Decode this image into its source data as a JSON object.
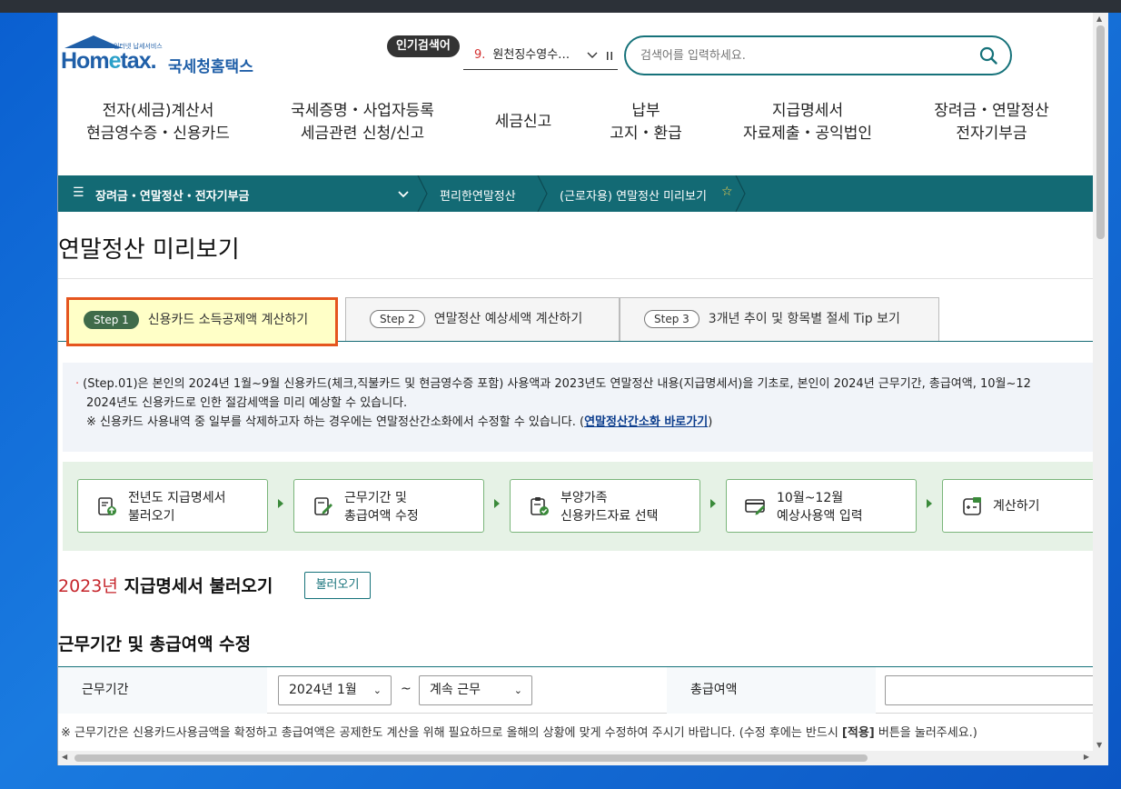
{
  "header": {
    "logo_small": "인터넷 납세서비스",
    "logo_brand_a": "Hom",
    "logo_brand_e": "e",
    "logo_brand_b": "tax.",
    "logo_ko": "국세청홈택스",
    "popular_label": "인기검색어",
    "popular_num": "9.",
    "popular_text": "원천징수영수…",
    "search_placeholder": "검색어를 입력하세요."
  },
  "gnb": [
    {
      "line1": "전자(세금)계산서",
      "line2": "현금영수증・신용카드"
    },
    {
      "line1": "국세증명・사업자등록",
      "line2": "세금관련 신청/신고"
    },
    {
      "line1": "세금신고",
      "line2": ""
    },
    {
      "line1": "납부",
      "line2": "고지・환급"
    },
    {
      "line1": "지급명세서",
      "line2": "자료제출・공익법인"
    },
    {
      "line1": "장려금・연말정산",
      "line2": "전자기부금"
    }
  ],
  "location": {
    "category": "장려금・연말정산・전자기부금",
    "crumb1": "편리한연말정산",
    "crumb2": "(근로자용) 연말정산 미리보기"
  },
  "page_title": "연말정산 미리보기",
  "tabs": [
    {
      "step": "Step 1",
      "label": "신용카드 소득공제액 계산하기"
    },
    {
      "step": "Step 2",
      "label": "연말정산 예상세액 계산하기"
    },
    {
      "step": "Step 3",
      "label": "3개년 추이 및 항목별 절세 Tip 보기"
    }
  ],
  "notice": {
    "line1": "(Step.01)은 본인의 2024년 1월~9월 신용카드(체크,직불카드 및 현금영수증 포함) 사용액과 2023년도 연말정산 내용(지급명세서)을 기초로, 본인이 2024년 근무기간, 총급여액, 10월~12",
    "line2": "2024년도 신용카드로 인한 절감세액을 미리 예상할 수 있습니다.",
    "line3_prefix": "※ 신용카드 사용내역 중 일부를 삭제하고자 하는 경우에는 연말정산간소화에서 수정할 수 있습니다. (",
    "line3_link": "연말정산간소화 바로가기",
    "line3_suffix": ")"
  },
  "steps": [
    {
      "line1": "전년도 지급명세서",
      "line2": "불러오기"
    },
    {
      "line1": "근무기간 및",
      "line2": "총급여액 수정"
    },
    {
      "line1": "부양가족",
      "line2": "신용카드자료 선택"
    },
    {
      "line1": "10월~12월",
      "line2": "예상사용액 입력"
    },
    {
      "line1": "계산하기",
      "line2": ""
    }
  ],
  "section1": {
    "year": "2023년",
    "title": " 지급명세서 불러오기",
    "button": "불러오기"
  },
  "section2": {
    "title": "근무기간 및 총급여액 수정",
    "period_label": "근무기간",
    "start_value": "2024년 1월",
    "tilde": "~",
    "end_value": "계속 근무",
    "salary_label": "총급여액",
    "note_prefix": "※ 근무기간은 신용카드사용금액을 확정하고 총급여액은 공제한도 계산을 위해 필요하므로 올해의 상황에 맞게 수정하여 주시기 바랍니다. (수정 후에는 반드시 ",
    "note_bold": "[적용]",
    "note_suffix": " 버튼을 눌러주세요.)"
  },
  "colors": {
    "brand": "#1f5fa8",
    "teal": "#136a74",
    "active_tab_border": "#e5551e",
    "active_tab_bg": "#ffffc7",
    "steps_bg": "#e6f2e6"
  }
}
